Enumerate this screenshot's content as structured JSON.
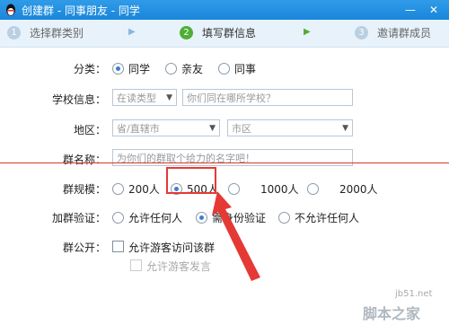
{
  "window": {
    "title": "创建群 - 同事朋友 - 同学"
  },
  "steps": [
    {
      "num": "1",
      "label": "选择群类别"
    },
    {
      "num": "2",
      "label": "填写群信息"
    },
    {
      "num": "3",
      "label": "邀请群成员"
    }
  ],
  "form": {
    "category": {
      "label": "分类：",
      "options": [
        "同学",
        "亲友",
        "同事"
      ],
      "selected": "同学"
    },
    "school": {
      "label": "学校信息：",
      "type_placeholder": "在读类型",
      "name_placeholder": "你们同在哪所学校？"
    },
    "region": {
      "label": "地区：",
      "city_placeholder": "省/直辖市",
      "district_placeholder": "市区"
    },
    "group_name": {
      "label": "群名称：",
      "placeholder": "为你们的群取个给力的名字吧！"
    },
    "size": {
      "label": "群规模：",
      "options": [
        "200人",
        "500人",
        "1000人",
        "2000人"
      ],
      "selected": "500人"
    },
    "verify": {
      "label": "加群验证：",
      "options": [
        "允许任何人",
        "需身份验证",
        "不允许任何人"
      ],
      "selected": "需身份验证"
    },
    "public": {
      "label": "群公开：",
      "allow_visitors": "允许游客访问该群",
      "allow_visitor_speech": "允许游客发言"
    }
  },
  "watermark": {
    "site": "jb51.net",
    "brand": "脚本之家"
  },
  "colors": {
    "titlebar": "#1a86da",
    "active_step": "#4fae36",
    "annotation": "#e53935"
  }
}
